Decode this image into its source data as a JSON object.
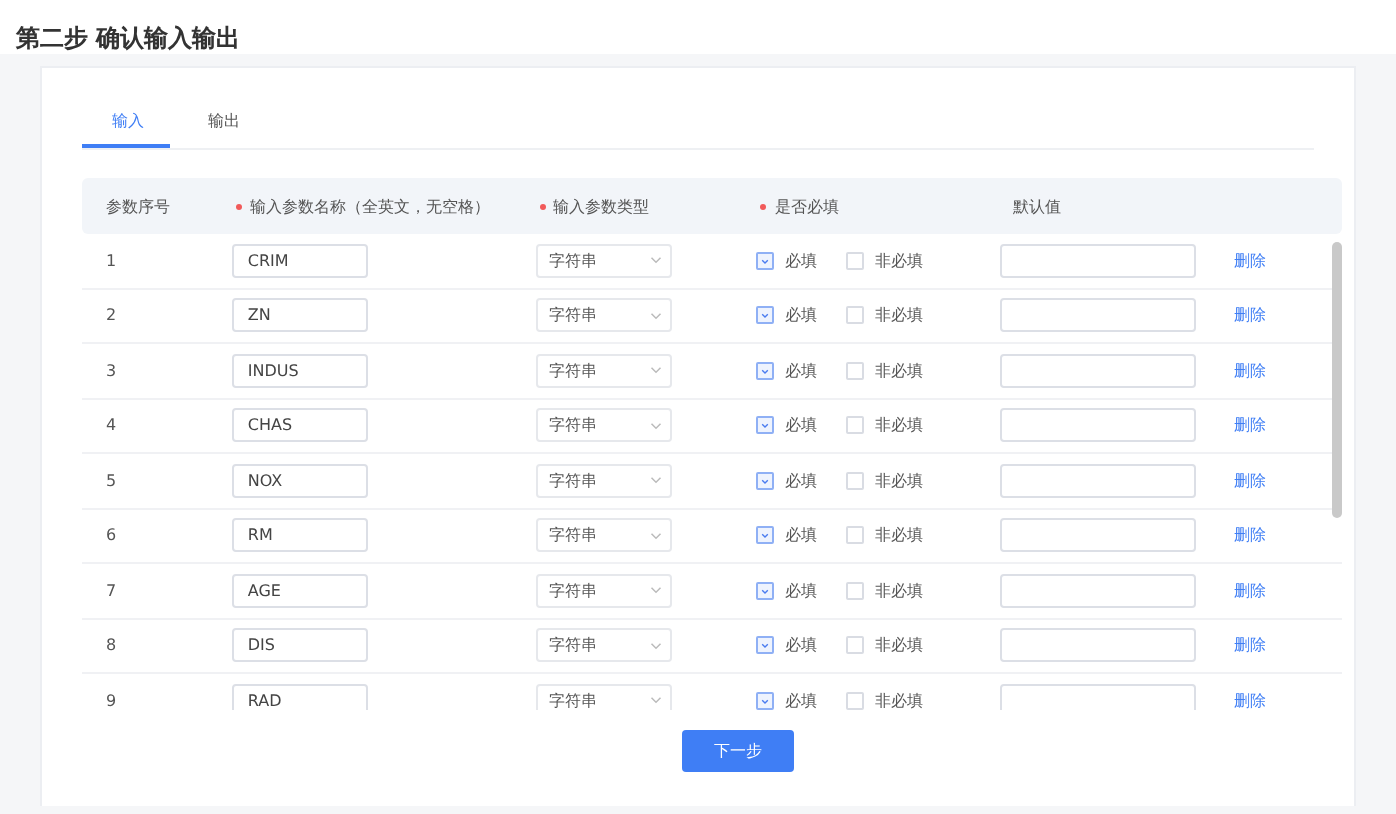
{
  "title": "第二步 确认输入输出",
  "tabs": [
    {
      "label": "输入",
      "selected": true
    },
    {
      "label": "输出",
      "selected": false
    }
  ],
  "table": {
    "columns": [
      {
        "label": "参数序号",
        "required_mark": false
      },
      {
        "label": "输入参数名称（全英文，无空格）",
        "required_mark": true
      },
      {
        "label": "输入参数类型",
        "required_mark": true
      },
      {
        "label": "是否必填",
        "required_mark": true
      },
      {
        "label": "默认值",
        "required_mark": false
      }
    ],
    "rows": [
      {
        "index": "1",
        "name": "CRIM",
        "type": "字符串",
        "required": true,
        "required_label": "必填",
        "optional_label": "非必填",
        "delete_label": "删除"
      },
      {
        "index": "2",
        "name": "ZN",
        "type": "字符串",
        "required": true,
        "required_label": "必填",
        "optional_label": "非必填",
        "delete_label": "删除"
      },
      {
        "index": "3",
        "name": "INDUS",
        "type": "字符串",
        "required": true,
        "required_label": "必填",
        "optional_label": "非必填",
        "delete_label": "删除"
      },
      {
        "index": "4",
        "name": "CHAS",
        "type": "字符串",
        "required": true,
        "required_label": "必填",
        "optional_label": "非必填",
        "delete_label": "删除"
      },
      {
        "index": "5",
        "name": "NOX",
        "type": "字符串",
        "required": true,
        "required_label": "必填",
        "optional_label": "非必填",
        "delete_label": "删除"
      },
      {
        "index": "6",
        "name": "RM",
        "type": "字符串",
        "required": true,
        "required_label": "必填",
        "optional_label": "非必填",
        "delete_label": "删除"
      },
      {
        "index": "7",
        "name": "AGE",
        "type": "字符串",
        "required": true,
        "required_label": "必填",
        "optional_label": "非必填",
        "delete_label": "删除"
      },
      {
        "index": "8",
        "name": "DIS",
        "type": "字符串",
        "required": true,
        "required_label": "必填",
        "optional_label": "非必填",
        "delete_label": "删除"
      },
      {
        "index": "9",
        "name": "RAD",
        "type": "字符串",
        "required": true,
        "required_label": "必填",
        "optional_label": "非必填",
        "delete_label": "删除"
      }
    ]
  },
  "next_button": "下一步"
}
